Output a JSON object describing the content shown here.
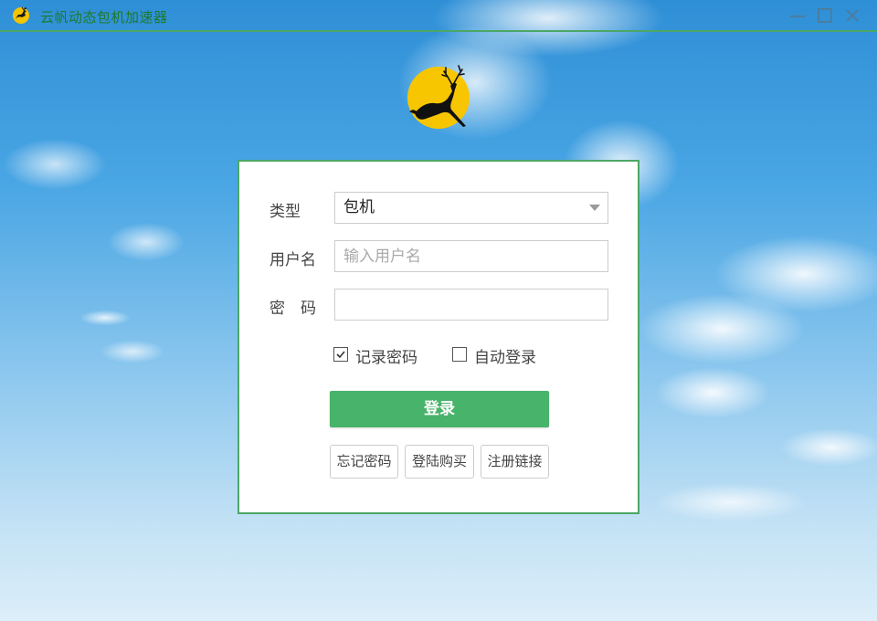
{
  "window": {
    "title": "云帆动态包机加速器",
    "icon": "deer-logo-icon",
    "controls": [
      "minimize-icon",
      "maximize-icon",
      "close-icon"
    ],
    "accent_color": "#4aa765"
  },
  "logo": {
    "icon": "leaping-deer-moon-icon",
    "moon_color": "#f5c400"
  },
  "form": {
    "type": {
      "label": "类型",
      "value": "包机"
    },
    "username": {
      "label": "用户名",
      "value": "",
      "placeholder": "输入用户名"
    },
    "password": {
      "label": "密　码",
      "value": ""
    },
    "remember_password": {
      "label": "记录密码",
      "checked": true
    },
    "auto_login": {
      "label": "自动登录",
      "checked": false
    },
    "login_button": "登录",
    "forgot_password_button": "忘记密码",
    "buy_button": "登陆购买",
    "register_button": "注册链接",
    "button_color": "#48b36a"
  }
}
